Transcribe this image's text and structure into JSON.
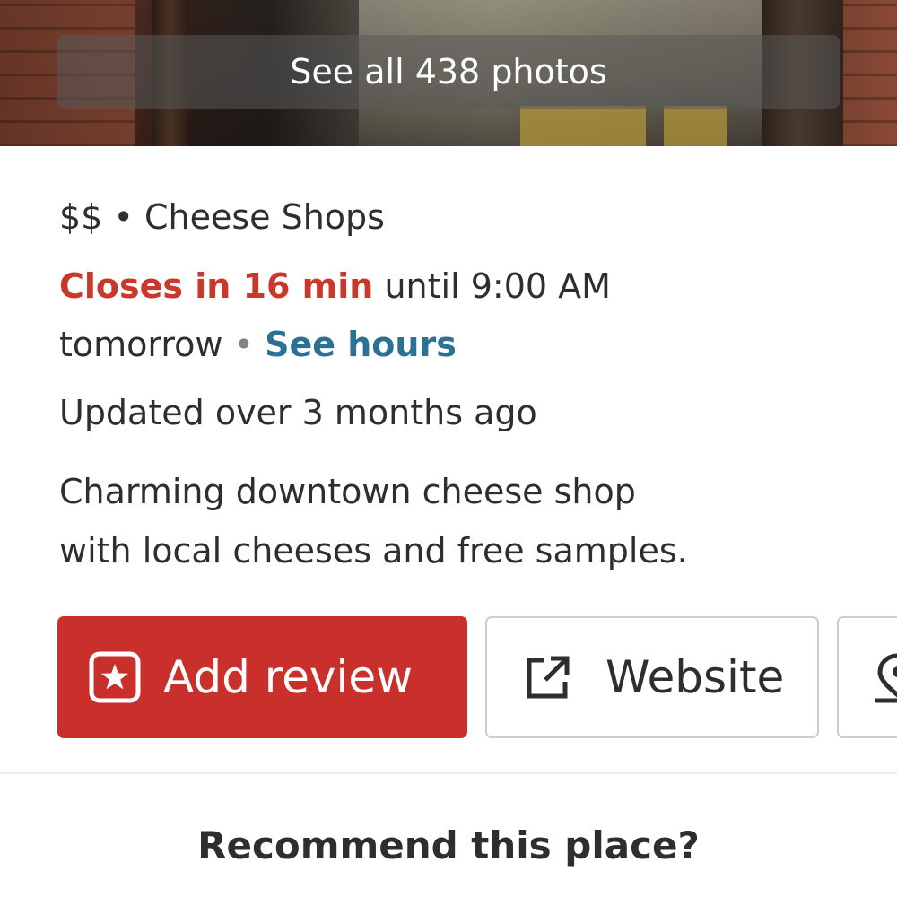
{
  "header": {
    "see_all_photos_label": "See all 438 photos"
  },
  "business": {
    "price": "$$",
    "separator": "•",
    "category": "Cheese Shops",
    "closing_status": "Closes in 16 min",
    "until_text": "until 9:00 AM",
    "tomorrow_text": "tomorrow",
    "see_hours_label": "See hours",
    "updated_text": "Updated over 3 months ago",
    "description_line1": "Charming downtown cheese shop",
    "description_line2": "with local cheeses and free samples."
  },
  "actions": {
    "add_review_label": "Add review",
    "add_review_icon": "star-square-icon",
    "website_label": "Website",
    "website_icon": "external-link-icon",
    "third_icon": "map-pin-icon"
  },
  "recommend": {
    "prompt": "Recommend this place?"
  },
  "colors": {
    "brand_red": "#c9302c",
    "closing_red": "#c8392b",
    "link_blue": "#2a7193",
    "text_dark": "#2d2e2f"
  }
}
